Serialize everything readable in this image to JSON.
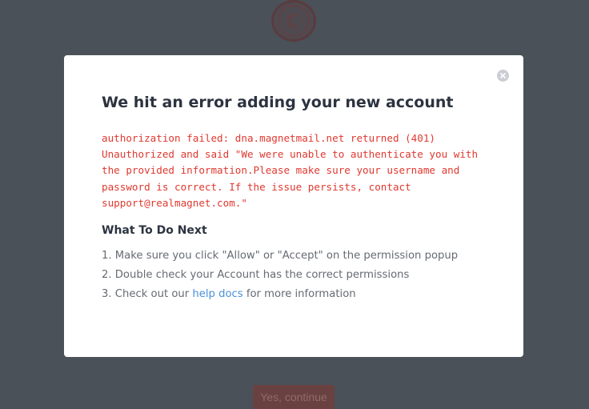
{
  "background": {
    "button_label": "Yes, continue"
  },
  "modal": {
    "title": "We hit an error adding your new account",
    "error_lines": [
      "authorization failed: dna.magnetmail.net returned (401)",
      "Unauthorized and said \"We were unable to authenticate you with",
      "the provided information.Please make sure your username and",
      "password is correct. If the issue persists, contact",
      "support@realmagnet.com.\""
    ],
    "next_heading": "What To Do Next",
    "steps": [
      "1. Make sure you click \"Allow\" or \"Accept\" on the permission popup",
      "2. Double check your Account has the correct permissions"
    ],
    "step3_prefix": "3. Check out our ",
    "step3_link": "help docs",
    "step3_suffix": " for more information"
  },
  "colors": {
    "overlay": "#4a5158",
    "error": "#e0382f",
    "link": "#4a90d9",
    "heading": "#2c3340",
    "body_text": "#666b73"
  },
  "icons": {
    "close": "close-icon",
    "logo": "app-logo-icon"
  }
}
